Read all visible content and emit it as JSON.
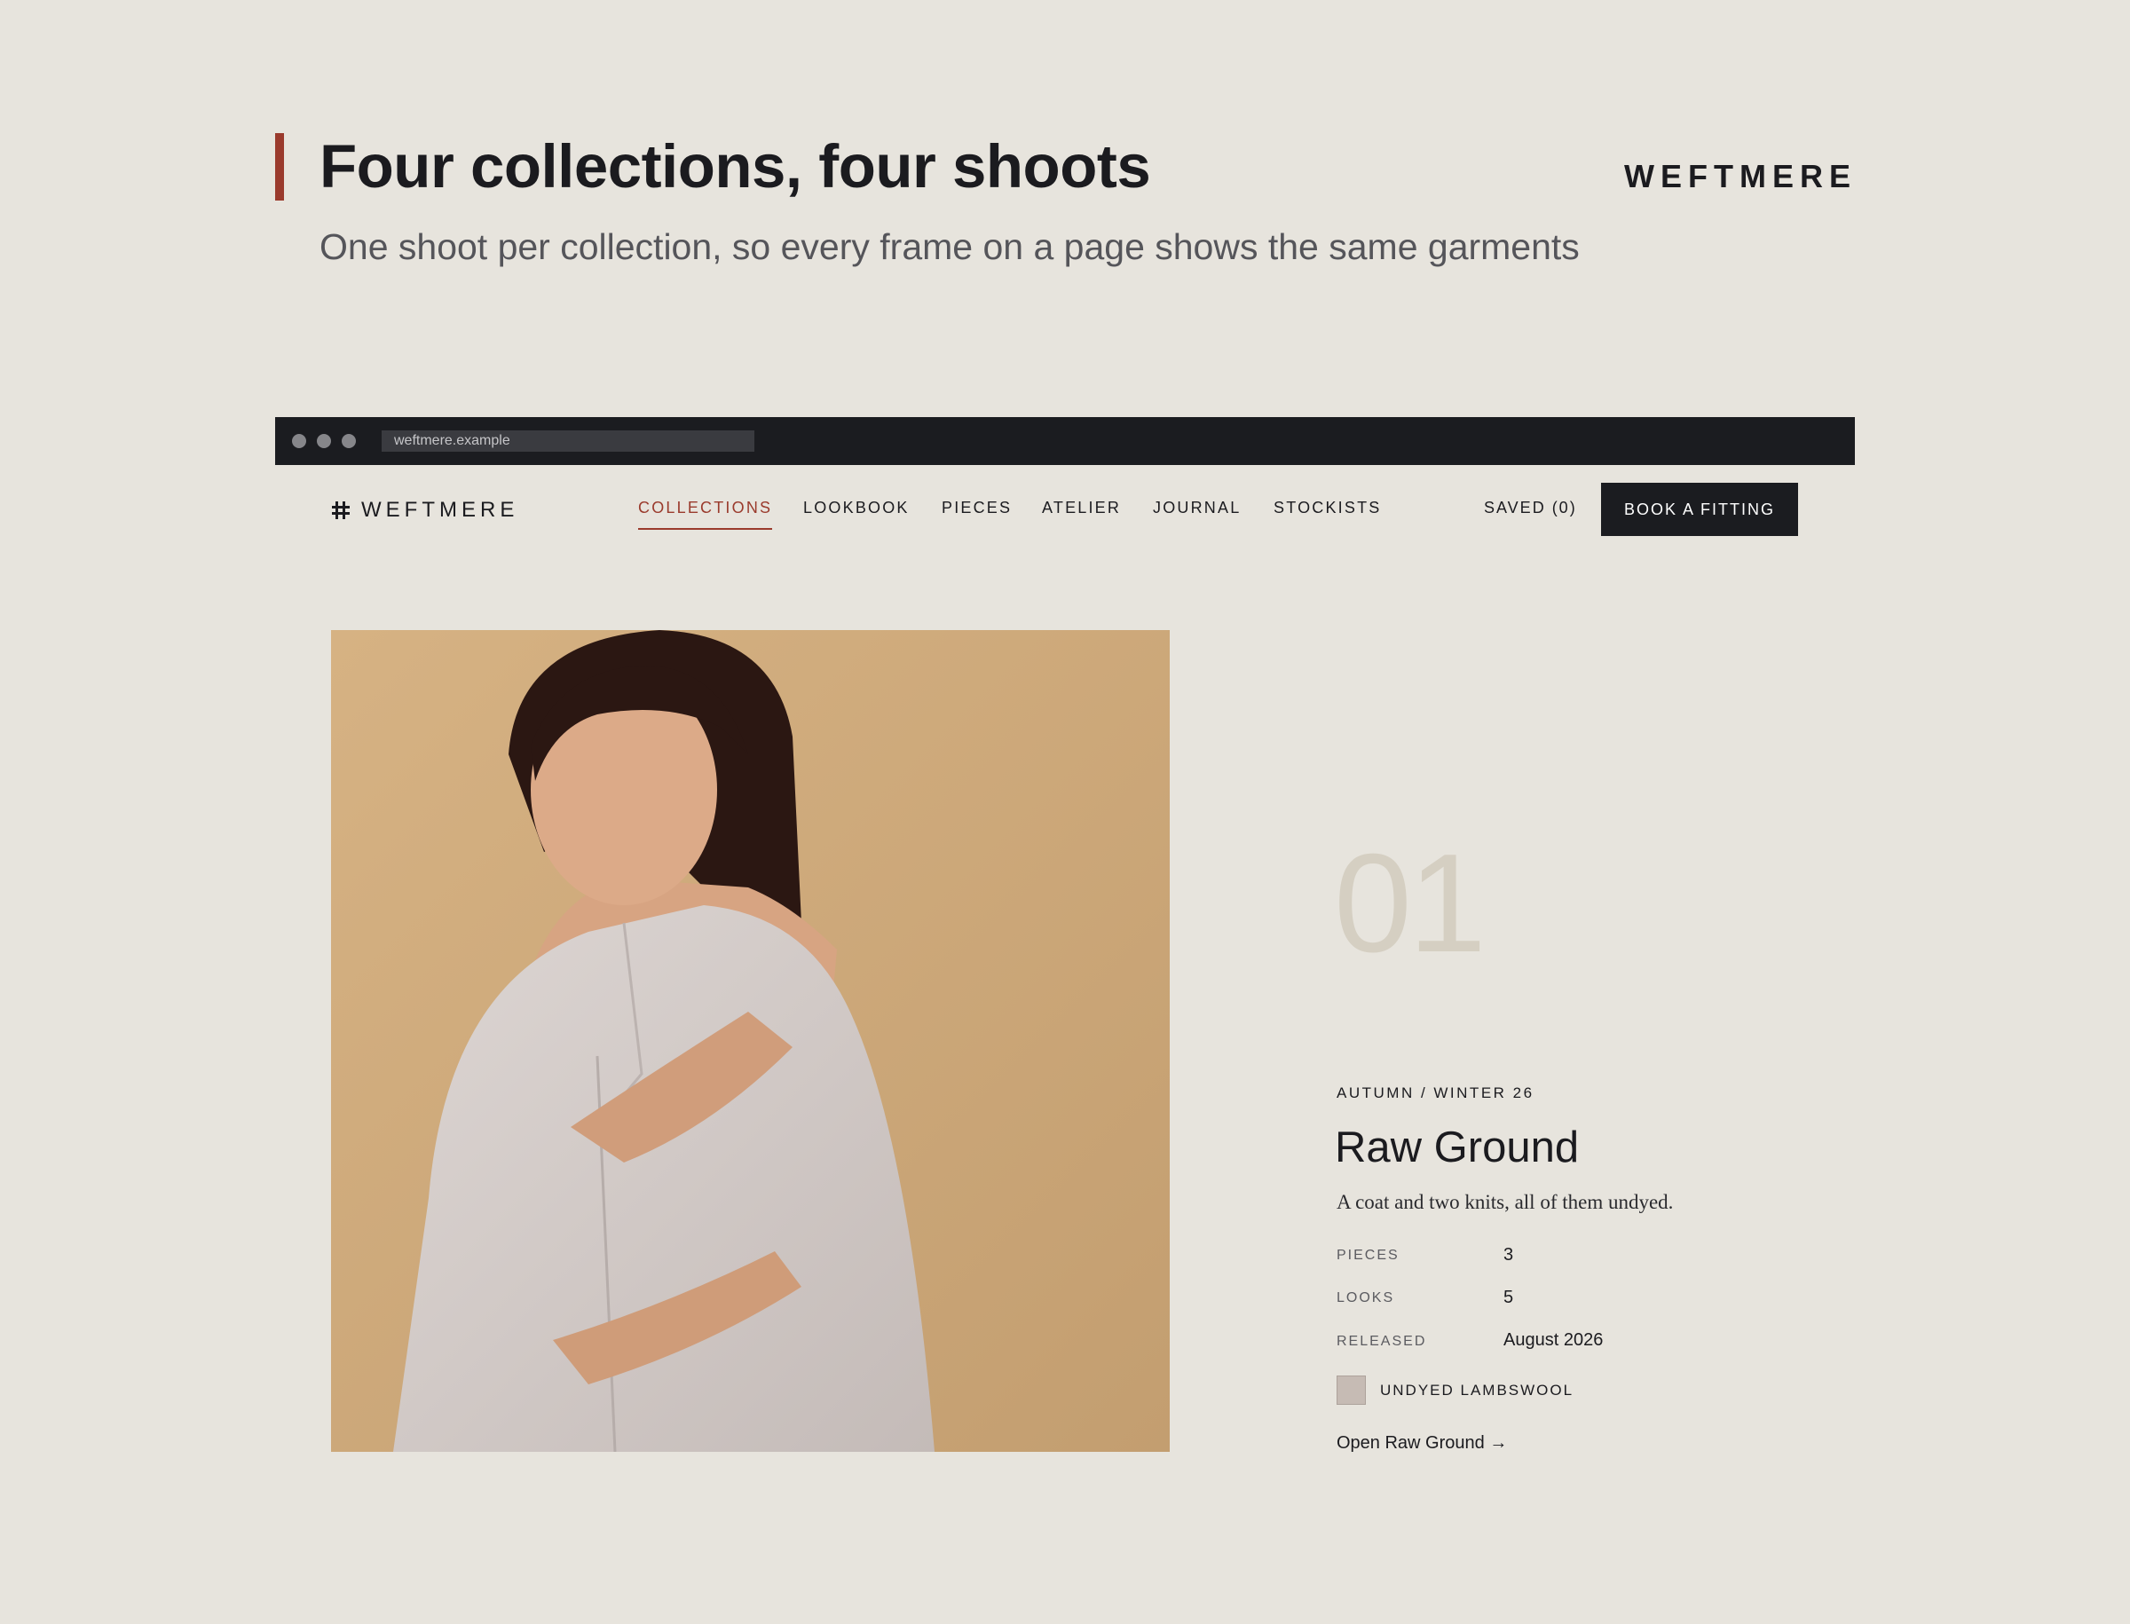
{
  "slide": {
    "title": "Four collections, four shoots",
    "subtitle": "One shoot per collection, so every frame on a page shows the same garments",
    "brand": "WEFTMERE",
    "accent_color": "#9a3a2c"
  },
  "browser": {
    "url": "weftmere.example"
  },
  "site": {
    "logo_text": "WEFTMERE",
    "logo_icon": "hash-mark-icon",
    "nav": {
      "items": [
        {
          "label": "COLLECTIONS",
          "active": true
        },
        {
          "label": "LOOKBOOK"
        },
        {
          "label": "PIECES"
        },
        {
          "label": "ATELIER"
        },
        {
          "label": "JOURNAL"
        },
        {
          "label": "STOCKISTS"
        }
      ]
    },
    "saved_label": "SAVED (0)",
    "cta_label": "BOOK A FITTING"
  },
  "collection": {
    "number": "01",
    "season": "AUTUMN / WINTER 26",
    "title": "Raw Ground",
    "description": "A coat and two knits, all of them undyed.",
    "stats": [
      {
        "label": "PIECES",
        "value": "3"
      },
      {
        "label": "LOOKS",
        "value": "5"
      },
      {
        "label": "RELEASED",
        "value": "August 2026"
      }
    ],
    "material": {
      "label": "UNDYED LAMBSWOOL",
      "swatch_color": "#c6bbb4"
    },
    "link_label": "Open Raw Ground →",
    "photo": {
      "background_color": "#c9a678",
      "coat_color": "#d9d2cf"
    }
  }
}
